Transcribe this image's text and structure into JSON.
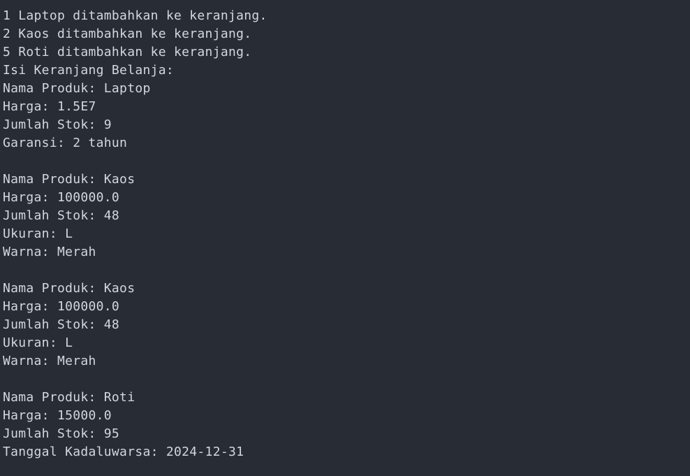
{
  "terminal": {
    "lines": [
      "1 Laptop ditambahkan ke keranjang.",
      "2 Kaos ditambahkan ke keranjang.",
      "5 Roti ditambahkan ke keranjang.",
      "Isi Keranjang Belanja:",
      "Nama Produk: Laptop",
      "Harga: 1.5E7",
      "Jumlah Stok: 9",
      "Garansi: 2 tahun",
      "",
      "Nama Produk: Kaos",
      "Harga: 100000.0",
      "Jumlah Stok: 48",
      "Ukuran: L",
      "Warna: Merah",
      "",
      "Nama Produk: Kaos",
      "Harga: 100000.0",
      "Jumlah Stok: 48",
      "Ukuran: L",
      "Warna: Merah",
      "",
      "Nama Produk: Roti",
      "Harga: 15000.0",
      "Jumlah Stok: 95",
      "Tanggal Kadaluwarsa: 2024-12-31"
    ]
  }
}
